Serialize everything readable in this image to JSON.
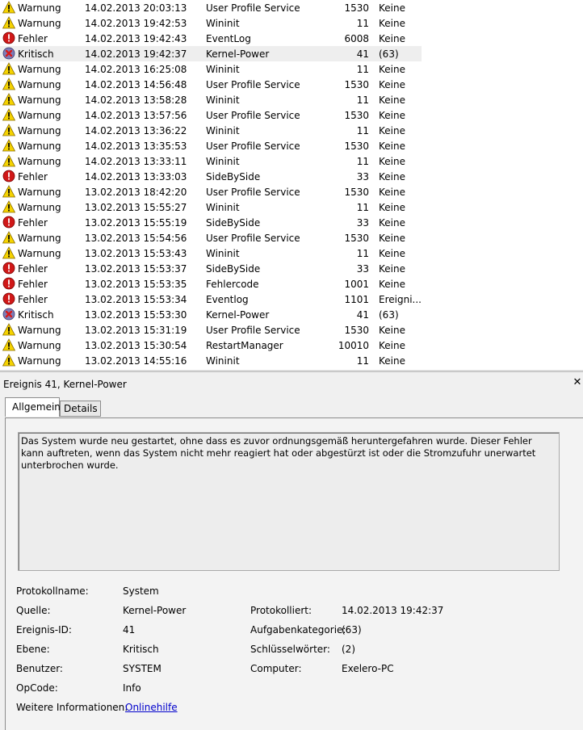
{
  "events": [
    {
      "level": "Warnung",
      "icon": "warning-icon",
      "date": "14.02.2013 20:03:13",
      "source": "User Profile Service",
      "id": "1530",
      "task": "Keine"
    },
    {
      "level": "Warnung",
      "icon": "warning-icon",
      "date": "14.02.2013 19:42:53",
      "source": "Wininit",
      "id": "11",
      "task": "Keine"
    },
    {
      "level": "Fehler",
      "icon": "error-icon",
      "date": "14.02.2013 19:42:43",
      "source": "EventLog",
      "id": "6008",
      "task": "Keine"
    },
    {
      "level": "Kritisch",
      "icon": "critical-icon",
      "date": "14.02.2013 19:42:37",
      "source": "Kernel-Power",
      "id": "41",
      "task": "(63)",
      "selected": true
    },
    {
      "level": "Warnung",
      "icon": "warning-icon",
      "date": "14.02.2013 16:25:08",
      "source": "Wininit",
      "id": "11",
      "task": "Keine"
    },
    {
      "level": "Warnung",
      "icon": "warning-icon",
      "date": "14.02.2013 14:56:48",
      "source": "User Profile Service",
      "id": "1530",
      "task": "Keine"
    },
    {
      "level": "Warnung",
      "icon": "warning-icon",
      "date": "14.02.2013 13:58:28",
      "source": "Wininit",
      "id": "11",
      "task": "Keine"
    },
    {
      "level": "Warnung",
      "icon": "warning-icon",
      "date": "14.02.2013 13:57:56",
      "source": "User Profile Service",
      "id": "1530",
      "task": "Keine"
    },
    {
      "level": "Warnung",
      "icon": "warning-icon",
      "date": "14.02.2013 13:36:22",
      "source": "Wininit",
      "id": "11",
      "task": "Keine"
    },
    {
      "level": "Warnung",
      "icon": "warning-icon",
      "date": "14.02.2013 13:35:53",
      "source": "User Profile Service",
      "id": "1530",
      "task": "Keine"
    },
    {
      "level": "Warnung",
      "icon": "warning-icon",
      "date": "14.02.2013 13:33:11",
      "source": "Wininit",
      "id": "11",
      "task": "Keine"
    },
    {
      "level": "Fehler",
      "icon": "error-icon",
      "date": "14.02.2013 13:33:03",
      "source": "SideBySide",
      "id": "33",
      "task": "Keine"
    },
    {
      "level": "Warnung",
      "icon": "warning-icon",
      "date": "13.02.2013 18:42:20",
      "source": "User Profile Service",
      "id": "1530",
      "task": "Keine"
    },
    {
      "level": "Warnung",
      "icon": "warning-icon",
      "date": "13.02.2013 15:55:27",
      "source": "Wininit",
      "id": "11",
      "task": "Keine"
    },
    {
      "level": "Fehler",
      "icon": "error-icon",
      "date": "13.02.2013 15:55:19",
      "source": "SideBySide",
      "id": "33",
      "task": "Keine"
    },
    {
      "level": "Warnung",
      "icon": "warning-icon",
      "date": "13.02.2013 15:54:56",
      "source": "User Profile Service",
      "id": "1530",
      "task": "Keine"
    },
    {
      "level": "Warnung",
      "icon": "warning-icon",
      "date": "13.02.2013 15:53:43",
      "source": "Wininit",
      "id": "11",
      "task": "Keine"
    },
    {
      "level": "Fehler",
      "icon": "error-icon",
      "date": "13.02.2013 15:53:37",
      "source": "SideBySide",
      "id": "33",
      "task": "Keine"
    },
    {
      "level": "Fehler",
      "icon": "error-icon",
      "date": "13.02.2013 15:53:35",
      "source": "Fehlercode",
      "id": "1001",
      "task": "Keine"
    },
    {
      "level": "Fehler",
      "icon": "error-icon",
      "date": "13.02.2013 15:53:34",
      "source": "Eventlog",
      "id": "1101",
      "task": "Ereigni..."
    },
    {
      "level": "Kritisch",
      "icon": "critical-icon",
      "date": "13.02.2013 15:53:30",
      "source": "Kernel-Power",
      "id": "41",
      "task": "(63)"
    },
    {
      "level": "Warnung",
      "icon": "warning-icon",
      "date": "13.02.2013 15:31:19",
      "source": "User Profile Service",
      "id": "1530",
      "task": "Keine"
    },
    {
      "level": "Warnung",
      "icon": "warning-icon",
      "date": "13.02.2013 15:30:54",
      "source": "RestartManager",
      "id": "10010",
      "task": "Keine"
    },
    {
      "level": "Warnung",
      "icon": "warning-icon",
      "date": "13.02.2013 14:55:16",
      "source": "Wininit",
      "id": "11",
      "task": "Keine"
    }
  ],
  "detail": {
    "title": "Ereignis 41, Kernel-Power",
    "close_icon": "close-icon",
    "tabs": [
      {
        "label": "Allgemein",
        "active": true
      },
      {
        "label": "Details",
        "active": false
      }
    ],
    "description": "Das System wurde neu gestartet, ohne dass es zuvor ordnungsgemäß heruntergefahren wurde. Dieser Fehler kann auftreten, wenn das System nicht mehr reagiert hat oder abgestürzt ist oder die Stromzufuhr unerwartet unterbrochen wurde.",
    "properties": {
      "log_name_label": "Protokollname:",
      "log_name": "System",
      "source_label": "Quelle:",
      "source": "Kernel-Power",
      "logged_label": "Protokolliert:",
      "logged": "14.02.2013 19:42:37",
      "event_id_label": "Ereignis-ID:",
      "event_id": "41",
      "task_category_label": "Aufgabenkategorie:",
      "task_category": "(63)",
      "level_label": "Ebene:",
      "level": "Kritisch",
      "keywords_label": "Schlüsselwörter:",
      "keywords": "(2)",
      "user_label": "Benutzer:",
      "user": "SYSTEM",
      "computer_label": "Computer:",
      "computer": "Exelero-PC",
      "opcode_label": "OpCode:",
      "opcode": "Info",
      "more_info_label": "Weitere Informationen:",
      "more_info_link": "Onlinehilfe"
    }
  },
  "colors": {
    "warning": "#f5d300",
    "error": "#d01818",
    "critical": "#7d7db8",
    "link": "#0000cc",
    "selection": "#eeeeee"
  }
}
